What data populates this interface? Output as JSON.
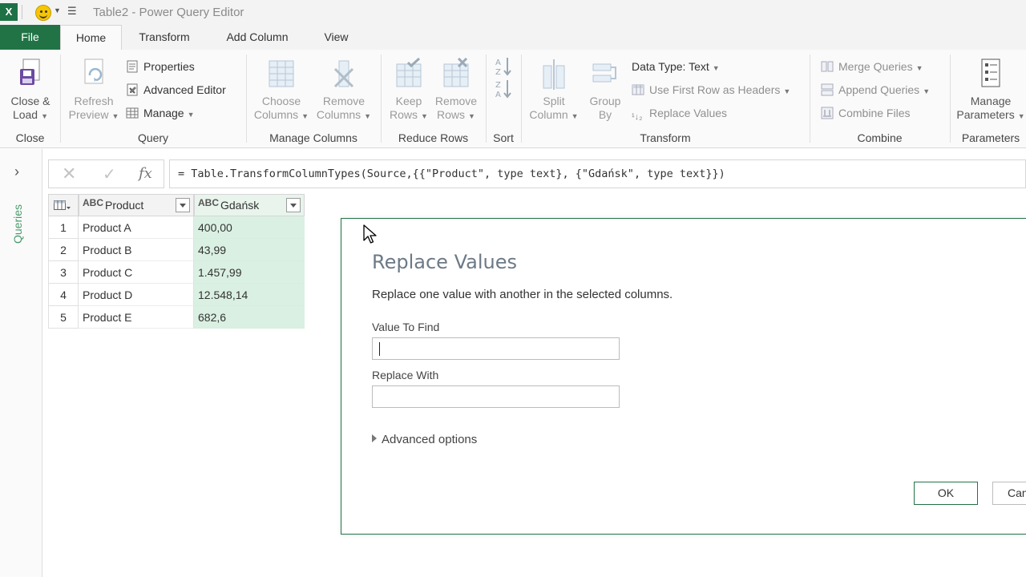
{
  "titlebar": {
    "app_icon": "X",
    "title": "Table2 - Power Query Editor"
  },
  "tabs": [
    {
      "label": "File"
    },
    {
      "label": "Home"
    },
    {
      "label": "Transform"
    },
    {
      "label": "Add Column"
    },
    {
      "label": "View"
    }
  ],
  "ribbon": {
    "close": {
      "close_load_1": "Close &",
      "close_load_2": "Load",
      "group": "Close"
    },
    "query": {
      "refresh_1": "Refresh",
      "refresh_2": "Preview",
      "properties": "Properties",
      "advanced_editor": "Advanced Editor",
      "manage": "Manage",
      "group": "Query"
    },
    "manage_columns": {
      "choose_1": "Choose",
      "choose_2": "Columns",
      "remove_1": "Remove",
      "remove_2": "Columns",
      "group": "Manage Columns"
    },
    "reduce_rows": {
      "keep_1": "Keep",
      "keep_2": "Rows",
      "remove_1": "Remove",
      "remove_2": "Rows",
      "group": "Reduce Rows"
    },
    "sort": {
      "group": "Sort"
    },
    "transform": {
      "split_1": "Split",
      "split_2": "Column",
      "group_by_1": "Group",
      "group_by_2": "By",
      "data_type": "Data Type: Text",
      "first_row": "Use First Row as Headers",
      "replace_values": "Replace Values",
      "group": "Transform"
    },
    "combine": {
      "merge": "Merge Queries",
      "append": "Append Queries",
      "combine_files": "Combine Files",
      "group": "Combine"
    },
    "parameters": {
      "manage_1": "Manage",
      "manage_2": "Parameters",
      "group": "Parameters"
    }
  },
  "left_panel": {
    "label": "Queries"
  },
  "formula_bar": {
    "formula": "= Table.TransformColumnTypes(Source,{{\"Product\", type text}, {\"Gdańsk\", type text}})"
  },
  "grid": {
    "columns": [
      "Product",
      "Gdańsk"
    ],
    "type_badge": "ABC",
    "rows": [
      {
        "n": "1",
        "product": "Product A",
        "value": "400,00"
      },
      {
        "n": "2",
        "product": "Product B",
        "value": "43,99"
      },
      {
        "n": "3",
        "product": "Product C",
        "value": "1.457,99"
      },
      {
        "n": "4",
        "product": "Product D",
        "value": "12.548,14"
      },
      {
        "n": "5",
        "product": "Product E",
        "value": "682,6"
      }
    ]
  },
  "dialog": {
    "title": "Replace Values",
    "description": "Replace one value with another in the selected columns.",
    "find_label": "Value To Find",
    "find_value": "",
    "replace_label": "Replace With",
    "replace_value": "",
    "advanced": "Advanced options",
    "ok": "OK",
    "cancel": "Can"
  },
  "colors": {
    "excel_green": "#217346",
    "selected_column": "#daf0e2",
    "title_text": "#6c7a86"
  }
}
